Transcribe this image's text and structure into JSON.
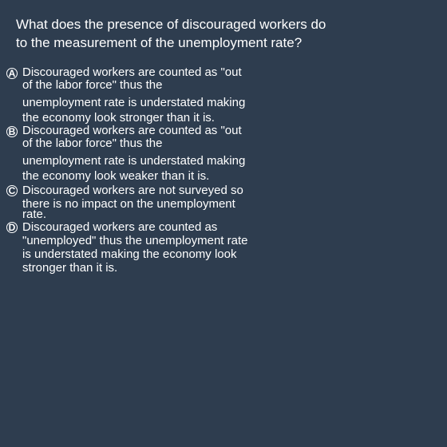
{
  "question": {
    "line1": "What does the presence of discouraged workers do",
    "line2": "to the measurement of the unemployment rate?"
  },
  "options": [
    {
      "letter": "A",
      "lines": [
        "Discouraged workers are counted as \"out",
        "of the labor force\" thus the",
        "unemployment rate is understated making",
        "the economy look stronger than it is."
      ]
    },
    {
      "letter": "B",
      "lines": [
        "Discouraged workers are counted as \"out",
        "of the labor force\" thus the",
        "unemployment rate is understated making",
        "the economy look weaker than it is."
      ]
    },
    {
      "letter": "C",
      "lines": [
        "Discouraged workers are not surveyed so",
        "there is no impact on the unemployment",
        "rate."
      ]
    },
    {
      "letter": "D",
      "lines": [
        "Discouraged workers are counted as",
        "\"unemployed\" thus the unemployment rate",
        "is understated making the economy look",
        "stronger than it is."
      ]
    }
  ]
}
